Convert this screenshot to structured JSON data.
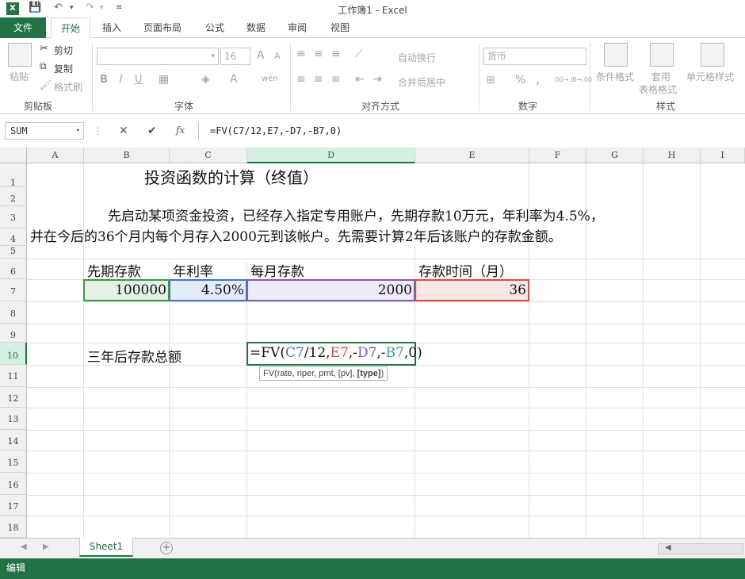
{
  "window": {
    "title": "工作簿1 - Excel"
  },
  "quick_access": {
    "save": "💾",
    "undo": "↶",
    "redo": "↷"
  },
  "tabs": {
    "file": "文件",
    "items": [
      "开始",
      "插入",
      "页面布局",
      "公式",
      "数据",
      "审阅",
      "视图"
    ]
  },
  "ribbon": {
    "clipboard": {
      "paste": "粘贴",
      "cut": "剪切",
      "copy": "复制",
      "painter": "格式刷",
      "label": "剪贴板"
    },
    "font": {
      "size": "16",
      "grow": "A",
      "shrink": "A",
      "bold": "B",
      "italic": "I",
      "underline": "U",
      "label": "字体",
      "phonetic": "wén"
    },
    "alignment": {
      "wrap": "自动换行",
      "merge": "合并后居中",
      "label": "对齐方式"
    },
    "number": {
      "format": "货币",
      "percent": "%",
      "comma": ",",
      "inc": ".00→.0",
      "dec": ".0→.00",
      "label": "数字"
    },
    "styles": {
      "conditional": "条件格式",
      "table1": "套用",
      "table2": "表格格式",
      "cell": "单元格样式",
      "label": "样式"
    }
  },
  "formula_bar": {
    "name_box": "SUM",
    "cancel": "✕",
    "enter": "✔",
    "fx": "fx",
    "formula": "=FV(C7/12,E7,-D7,-B7,0)"
  },
  "columns": [
    "A",
    "B",
    "C",
    "D",
    "E",
    "F",
    "G",
    "H",
    "I"
  ],
  "rows": [
    "1",
    "2",
    "3",
    "4",
    "5",
    "6",
    "7",
    "8",
    "9",
    "10",
    "11",
    "12",
    "13",
    "14",
    "15",
    "16",
    "17",
    "18"
  ],
  "cells": {
    "title": "投资函数的计算（终值）",
    "desc1": "先启动某项资金投资，已经存入指定专用账户，先期存款10万元，年利率为4.5%，",
    "desc2": "并在今后的36个月内每个月存入2000元到该帐户。先需要计算2年后该账户的存款金额。",
    "h_b6": "先期存款",
    "h_c6": "年利率",
    "h_d6": "每月存款",
    "h_e6": "存款时间（月）",
    "v_b7": "100000",
    "v_c7": "4.50%",
    "v_d7": "2000",
    "v_e7": "36",
    "label_b10": "三年后存款总额",
    "edit": {
      "p0": "=FV(",
      "p1": "C7",
      "p2": "/12,",
      "p3": "E7",
      "p4": ",-",
      "p5": "D7",
      "p6": ",-",
      "p7": "B7",
      "p8": ",",
      "p9": "0",
      "p10": ")"
    },
    "tooltip": "FV(rate, nper, pmt, [pv], ",
    "tooltip_bold": "[type]",
    "tooltip_end": ")"
  },
  "sheet": {
    "name": "Sheet1",
    "add": "+"
  },
  "status": {
    "mode": "编辑"
  },
  "colors": {
    "excel_green": "#217346",
    "ref_blue": "#4472c4",
    "ref_red": "#e04a3a",
    "ref_purple": "#7e5bb5",
    "ref_teal": "#3aa0a0"
  }
}
